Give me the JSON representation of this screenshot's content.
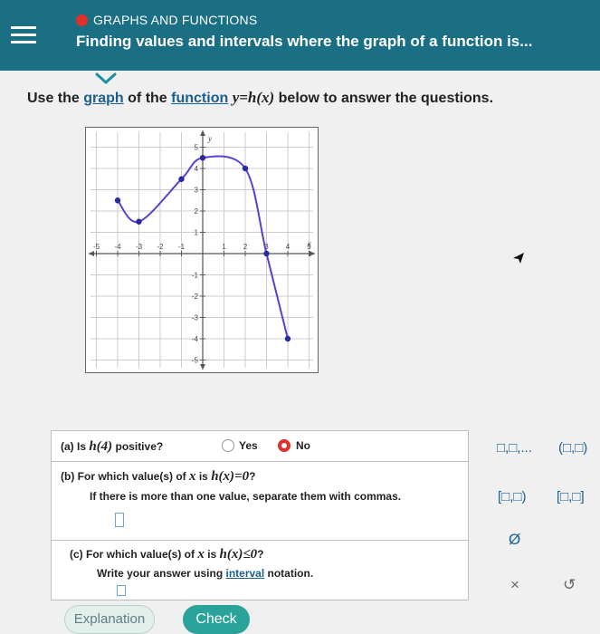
{
  "header": {
    "topic": "GRAPHS AND FUNCTIONS",
    "title": "Finding values and intervals where the graph of a function is..."
  },
  "prompt": {
    "part1": "Use the ",
    "graph_link": "graph",
    "part2": " of the ",
    "function_link": "function",
    "part3": " ",
    "math": "y=h(x)",
    "part4": " below to answer the questions."
  },
  "graph": {
    "y_label": "y",
    "x_label": "x",
    "x_ticks": [
      "-5",
      "-4",
      "-3",
      "-2",
      "-1",
      "1",
      "2",
      "3",
      "4",
      "5"
    ],
    "y_ticks": [
      "5",
      "4",
      "3",
      "2",
      "1",
      "-1",
      "-2",
      "-3",
      "-4",
      "-5"
    ],
    "points": [
      [
        -4,
        2.5
      ],
      [
        -3,
        1.5
      ],
      [
        -1,
        3.5
      ],
      [
        0,
        4.5
      ],
      [
        2,
        4
      ],
      [
        3,
        0
      ],
      [
        4,
        -4
      ]
    ]
  },
  "questions": {
    "a": {
      "text_prefix": "(a)  Is ",
      "math": "h(4)",
      "text_suffix": " positive?",
      "options": [
        {
          "label": "Yes",
          "selected": false
        },
        {
          "label": "No",
          "selected": true
        }
      ]
    },
    "b": {
      "text_prefix": "(b)  For which value(s) of ",
      "math_x": "x",
      "text_mid": " is ",
      "math": "h(x)=0",
      "text_suffix": "?",
      "hint": "If there is more than one value, separate them with commas."
    },
    "c": {
      "text_prefix": "(c)  For which value(s) of ",
      "math_x": "x",
      "text_mid": " is ",
      "math": "h(x)≤0",
      "text_suffix": "?",
      "hint_prefix": "Write your answer using ",
      "hint_link": "interval",
      "hint_suffix": " notation."
    }
  },
  "tools": {
    "list": "□,□,...",
    "open_interval": "(□,□)",
    "half_closed_right": "[□,□)",
    "closed_interval": "[□,□]",
    "empty_set": "Ø",
    "clear": "×",
    "undo": "↺"
  },
  "buttons": {
    "explanation": "Explanation",
    "check": "Check"
  },
  "colors": {
    "header": "#1a6f84",
    "accent_red": "#e0302a",
    "curve": "#5b3fcf",
    "check_button": "#2aa49b"
  }
}
